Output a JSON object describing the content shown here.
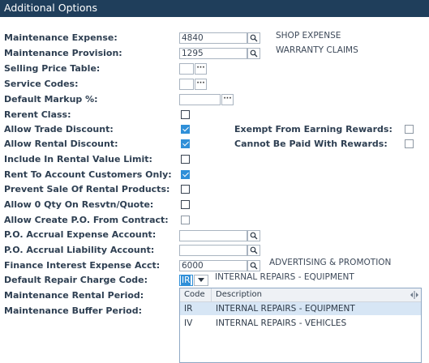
{
  "header": {
    "title": "Additional Options"
  },
  "form": {
    "maintenance_expense": {
      "label": "Maintenance Expense:",
      "value": "4840",
      "desc": "SHOP EXPENSE"
    },
    "maintenance_provision": {
      "label": "Maintenance Provision:",
      "value": "1295",
      "desc": "WARRANTY CLAIMS"
    },
    "selling_price_table": {
      "label": "Selling Price Table:"
    },
    "service_codes": {
      "label": "Service Codes:"
    },
    "default_markup": {
      "label": "Default Markup %:"
    },
    "rerent_class": {
      "label": "Rerent Class:",
      "checked": false
    },
    "allow_trade_discount": {
      "label": "Allow Trade Discount:",
      "checked": true
    },
    "allow_rental_discount": {
      "label": "Allow Rental Discount:",
      "checked": true
    },
    "include_rental_value_limit": {
      "label": "Include In Rental Value Limit:",
      "checked": false
    },
    "rent_to_account_only": {
      "label": "Rent To Account Customers Only:",
      "checked": true
    },
    "prevent_sale_rental": {
      "label": "Prevent Sale Of Rental Products:",
      "checked": false
    },
    "allow_zero_qty": {
      "label": "Allow 0 Qty On Resvtn/Quote:",
      "checked": false
    },
    "allow_create_po": {
      "label": "Allow Create P.O. From Contract:",
      "checked": false
    },
    "po_accrual_expense": {
      "label": "P.O. Accrual Expense Account:",
      "value": ""
    },
    "po_accrual_liability": {
      "label": "P.O. Accrual Liability Account:",
      "value": ""
    },
    "finance_interest_expense": {
      "label": "Finance Interest Expense Acct:",
      "value": "6000",
      "desc": "ADVERTISING & PROMOTION"
    },
    "default_repair_charge": {
      "label": "Default Repair Charge Code:",
      "value": "IR",
      "desc": "INTERNAL REPAIRS - EQUIPMENT"
    },
    "maintenance_rental_period": {
      "label": "Maintenance Rental Period:"
    },
    "maintenance_buffer_period": {
      "label": "Maintenance Buffer Period:"
    },
    "exempt_earning_rewards": {
      "label": "Exempt From Earning Rewards:",
      "checked": false
    },
    "cannot_pay_rewards": {
      "label": "Cannot Be Paid With Rewards:",
      "checked": false
    }
  },
  "dropdown": {
    "columns": [
      "Code",
      "Description"
    ],
    "rows": [
      {
        "code": "IR",
        "description": "INTERNAL REPAIRS - EQUIPMENT",
        "selected": true
      },
      {
        "code": "IV",
        "description": "INTERNAL REPAIRS - VEHICLES",
        "selected": false
      }
    ]
  },
  "icons": {
    "search": "search-icon",
    "ellipsis": "ellipsis-icon",
    "caret": "caret-down-icon",
    "resize": "column-resize-icon"
  },
  "colors": {
    "header_bg": "#1f3e5b",
    "check_blue": "#2f8fd8",
    "selection": "#d7e6f5"
  }
}
